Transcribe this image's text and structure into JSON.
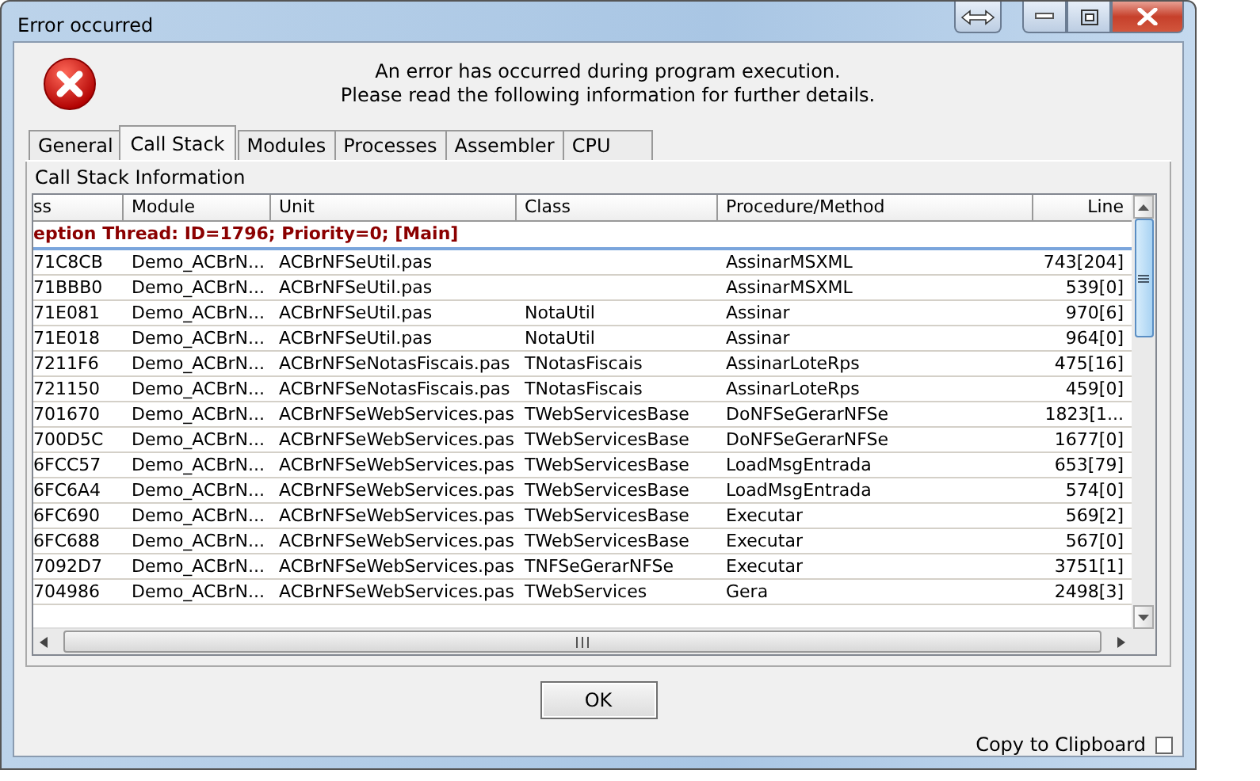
{
  "window": {
    "title": "Error occurred"
  },
  "message": [
    "An error has occurred during program execution.",
    "Please read the following information for further details."
  ],
  "tabs": [
    {
      "label": "General",
      "selected": false
    },
    {
      "label": "Call Stack",
      "selected": true
    },
    {
      "label": "Modules",
      "selected": false
    },
    {
      "label": "Processes",
      "selected": false
    },
    {
      "label": "Assembler",
      "selected": false
    },
    {
      "label": "CPU",
      "selected": false
    }
  ],
  "panel_title": "Call Stack Information",
  "table": {
    "columns": [
      "ss",
      "Module",
      "Unit",
      "Class",
      "Procedure/Method",
      "Line"
    ],
    "thread_row": "eption Thread: ID=1796; Priority=0; [Main]",
    "rows": [
      [
        "71C8CB",
        "Demo_ACBrN...",
        "ACBrNFSeUtil.pas",
        "",
        "AssinarMSXML",
        "743[204]"
      ],
      [
        "71BBB0",
        "Demo_ACBrN...",
        "ACBrNFSeUtil.pas",
        "",
        "AssinarMSXML",
        "539[0]"
      ],
      [
        "71E081",
        "Demo_ACBrN...",
        "ACBrNFSeUtil.pas",
        "NotaUtil",
        "Assinar",
        "970[6]"
      ],
      [
        "71E018",
        "Demo_ACBrN...",
        "ACBrNFSeUtil.pas",
        "NotaUtil",
        "Assinar",
        "964[0]"
      ],
      [
        "7211F6",
        "Demo_ACBrN...",
        "ACBrNFSeNotasFiscais.pas",
        "TNotasFiscais",
        "AssinarLoteRps",
        "475[16]"
      ],
      [
        "721150",
        "Demo_ACBrN...",
        "ACBrNFSeNotasFiscais.pas",
        "TNotasFiscais",
        "AssinarLoteRps",
        "459[0]"
      ],
      [
        "701670",
        "Demo_ACBrN...",
        "ACBrNFSeWebServices.pas",
        "TWebServicesBase",
        "DoNFSeGerarNFSe",
        "1823[1..."
      ],
      [
        "700D5C",
        "Demo_ACBrN...",
        "ACBrNFSeWebServices.pas",
        "TWebServicesBase",
        "DoNFSeGerarNFSe",
        "1677[0]"
      ],
      [
        "6FCC57",
        "Demo_ACBrN...",
        "ACBrNFSeWebServices.pas",
        "TWebServicesBase",
        "LoadMsgEntrada",
        "653[79]"
      ],
      [
        "6FC6A4",
        "Demo_ACBrN...",
        "ACBrNFSeWebServices.pas",
        "TWebServicesBase",
        "LoadMsgEntrada",
        "574[0]"
      ],
      [
        "6FC690",
        "Demo_ACBrN...",
        "ACBrNFSeWebServices.pas",
        "TWebServicesBase",
        "Executar",
        "569[2]"
      ],
      [
        "6FC688",
        "Demo_ACBrN...",
        "ACBrNFSeWebServices.pas",
        "TWebServicesBase",
        "Executar",
        "567[0]"
      ],
      [
        "7092D7",
        "Demo_ACBrN...",
        "ACBrNFSeWebServices.pas",
        "TNFSeGerarNFSe",
        "Executar",
        "3751[1]"
      ],
      [
        "704986",
        "Demo_ACBrN...",
        "ACBrNFSeWebServices.pas",
        "TWebServices",
        "Gera",
        "2498[3]"
      ]
    ]
  },
  "ok_button": "OK",
  "copy_to_clipboard": {
    "label": "Copy to Clipboard",
    "checked": false
  }
}
